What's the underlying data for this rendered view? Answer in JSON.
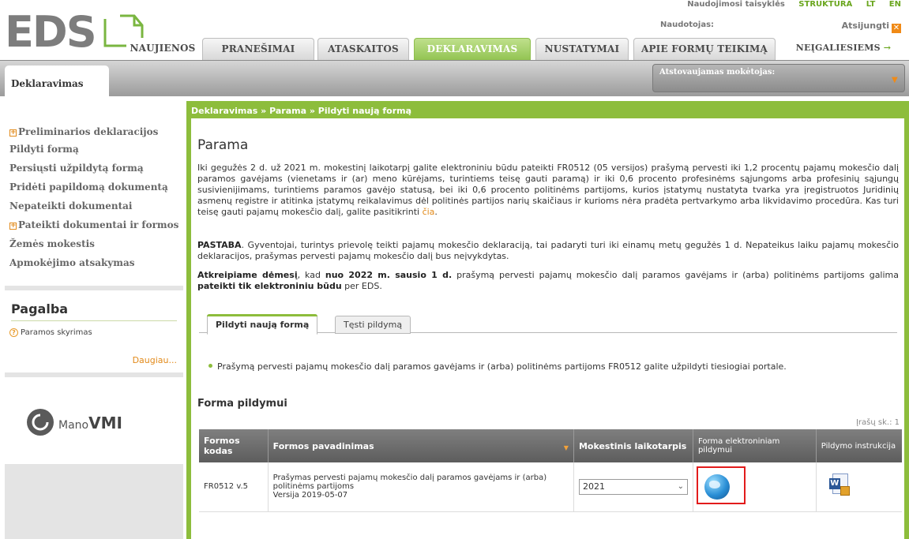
{
  "header": {
    "logo": "EDS",
    "util_links": [
      "Naudojimosi taisyklės",
      "STRUKTŪRA",
      "LT",
      "EN"
    ],
    "user_label": "Naudotojas:",
    "logout_label": "Atsijungti"
  },
  "tabs": [
    {
      "label": "NAUJIENOS",
      "state": "plain"
    },
    {
      "label": "PRANEŠIMAI",
      "state": "normal"
    },
    {
      "label": "ATASKAITOS",
      "state": "normal"
    },
    {
      "label": "DEKLARAVIMAS",
      "state": "active"
    },
    {
      "label": "NUSTATYMAI",
      "state": "normal"
    },
    {
      "label": "APIE FORMŲ TEIKIMĄ",
      "state": "normal"
    },
    {
      "label": "NEĮGALIESIEMS",
      "state": "plain"
    }
  ],
  "subbar": {
    "section_tab": "Deklaravimas",
    "payer_label": "Atstovaujamas mokėtojas:"
  },
  "sidebar": {
    "items": [
      {
        "label": "Preliminarios deklaracijos",
        "expandable": true
      },
      {
        "label": "Pildyti formą",
        "expandable": false
      },
      {
        "label": "Persiųsti užpildytą formą",
        "expandable": false
      },
      {
        "label": "Pridėti papildomą dokumentą",
        "expandable": false
      },
      {
        "label": "Nepateikti dokumentai",
        "expandable": false
      },
      {
        "label": "Pateikti dokumentai ir formos",
        "expandable": true
      },
      {
        "label": "Žemės mokestis",
        "expandable": false
      },
      {
        "label": "Apmokėjimo atsakymas",
        "expandable": false
      }
    ],
    "help_title": "Pagalba",
    "help_item": "Paramos skyrimas",
    "help_more": "Daugiau...",
    "vmi_logo": {
      "prefix": "Mano",
      "main": "VMI"
    }
  },
  "main": {
    "breadcrumb": "Deklaravimas » Parama » Pildyti naują formą",
    "title": "Parama",
    "para1": "Iki gegužės 2 d. už 2021 m. mokestinį laikotarpį galite elektroniniu būdu pateikti FR0512 (05 versijos) prašymą pervesti iki 1,2 procentų pajamų mokesčio dalį paramos gavėjams (vienetams ir (ar) meno kūrėjams, turintiems teisę gauti paramą) ir iki 0,6 procento profesinėms sąjungoms arba profesinių sąjungų susivienijimams, turintiems paramos gavėjo statusą, bei iki 0,6 procento politinėms partijoms, kurios įstatymų nustatyta tvarka yra įregistruotos Juridinių asmenų registre ir atitinka įstatymų reikalavimus dėl politinės partijos narių skaičiaus ir kurioms nėra pradėta pertvarkymo arba likvidavimo procedūra. Kas turi teisę gauti pajamų mokesčio dalį, galite pasitikrinti",
    "para1_link": "čia",
    "para2_bold": "PASTABA",
    "para2": ". Gyventojai, turintys prievolę teikti pajamų mokesčio deklaraciją, tai padaryti turi iki einamų metų gegužės 1 d. Nepateikus laiku pajamų mokesčio deklaracijos, prašymas pervesti pajamų mokesčio dalį bus neįvykdytas.",
    "para3_a": "Atkreipiame dėmesį",
    "para3_b": ", kad ",
    "para3_c": "nuo 2022 m. sausio 1 d.",
    "para3_d": " prašymą pervesti pajamų mokesčio dalį paramos gavėjams ir (arba) politinėms partijoms galima ",
    "para3_e": "pateikti tik elektroniniu būdu",
    "para3_f": " per EDS.",
    "tabs": [
      {
        "label": "Pildyti naują formą",
        "active": true
      },
      {
        "label": "Tęsti pildymą",
        "active": false
      }
    ],
    "bullet": "Prašymą pervesti pajamų mokesčio dalį paramos gavėjams ir (arba) politinėms partijoms FR0512 galite užpildyti tiesiogiai portale.",
    "form_title": "Forma pildymui",
    "record_count": "Įrašų sk.: 1",
    "table": {
      "headers": [
        "Formos kodas",
        "Formos pavadinimas",
        "Mokestinis laikotarpis",
        "Forma elektroniniam pildymui",
        "Pildymo instrukcija"
      ],
      "rows": [
        {
          "code": "FR0512 v.5",
          "name": "Prašymas pervesti pajamų mokesčio dalį paramos gavėjams ir (arba) politinėms partijoms",
          "version": "Versija 2019-05-07",
          "period": "2021"
        }
      ]
    }
  }
}
